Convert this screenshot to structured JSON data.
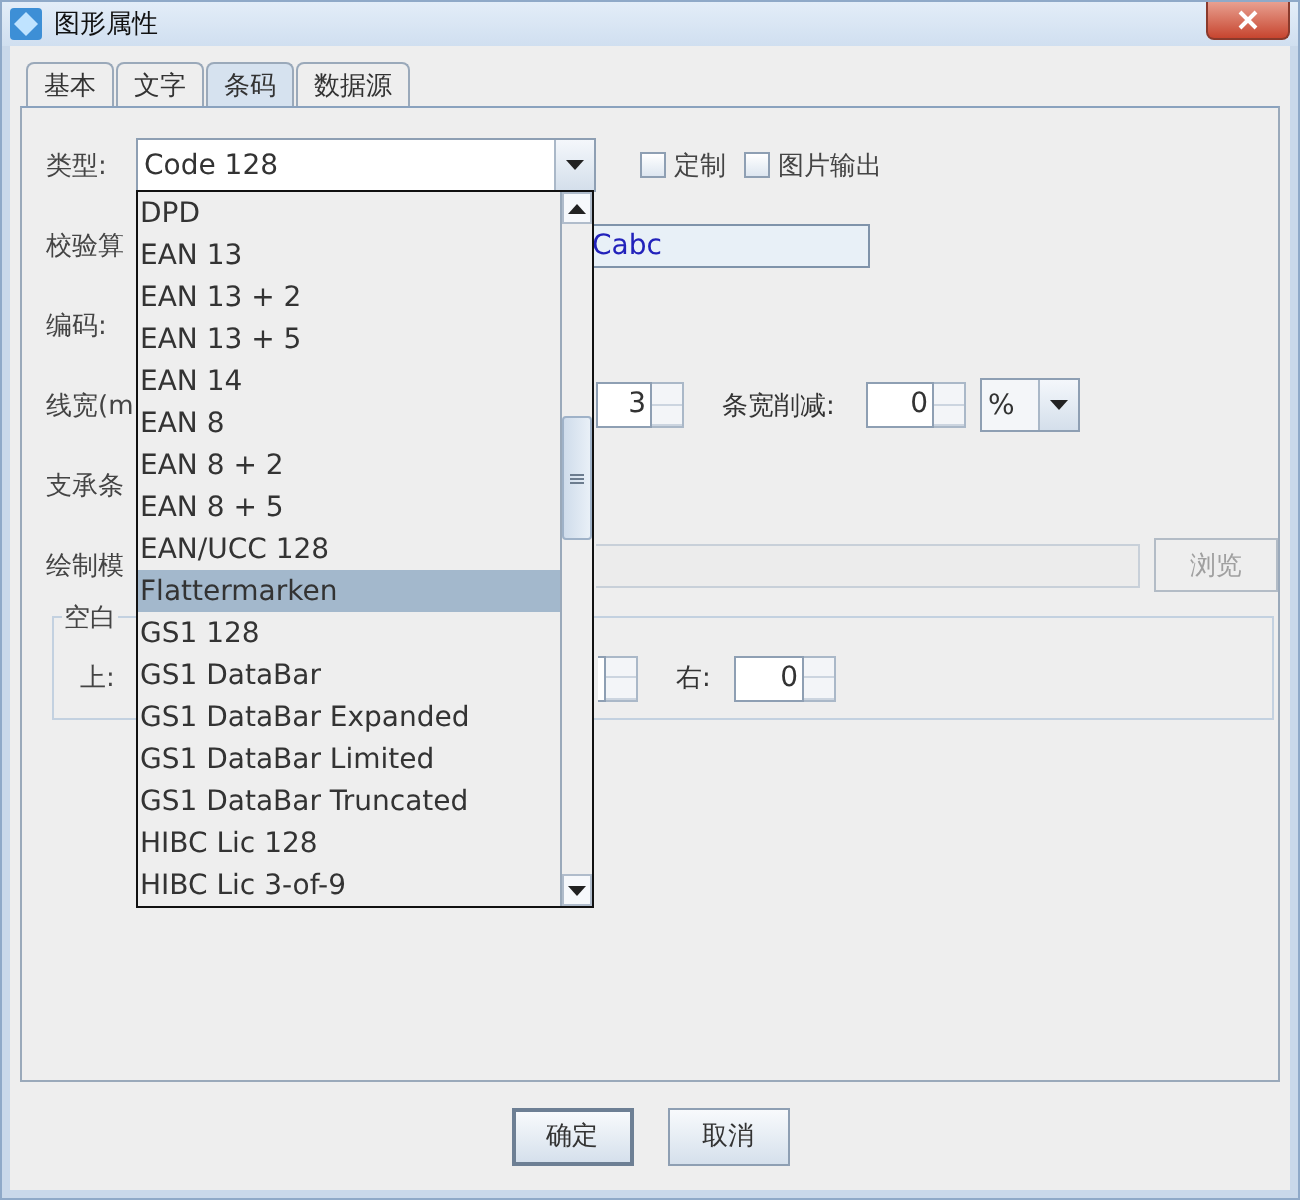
{
  "window": {
    "title": "图形属性"
  },
  "tabs": [
    {
      "label": "基本",
      "selected": false
    },
    {
      "label": "文字",
      "selected": false
    },
    {
      "label": "条码",
      "selected": true
    },
    {
      "label": "数据源",
      "selected": false
    }
  ],
  "barcode_type": {
    "label": "类型:",
    "value": "Code 128",
    "options": [
      {
        "label": "DPD",
        "selected": false
      },
      {
        "label": "EAN 13",
        "selected": false
      },
      {
        "label": "EAN 13 + 2",
        "selected": false
      },
      {
        "label": "EAN 13 + 5",
        "selected": false
      },
      {
        "label": "EAN 14",
        "selected": false
      },
      {
        "label": "EAN 8",
        "selected": false
      },
      {
        "label": "EAN 8 + 2",
        "selected": false
      },
      {
        "label": "EAN 8 + 5",
        "selected": false
      },
      {
        "label": "EAN/UCC 128",
        "selected": false
      },
      {
        "label": "Flattermarken",
        "selected": true
      },
      {
        "label": "GS1 128",
        "selected": false
      },
      {
        "label": "GS1 DataBar",
        "selected": false
      },
      {
        "label": "GS1 DataBar Expanded",
        "selected": false
      },
      {
        "label": "GS1 DataBar Limited",
        "selected": false
      },
      {
        "label": "GS1 DataBar Truncated",
        "selected": false
      },
      {
        "label": "HIBC Lic 128",
        "selected": false
      },
      {
        "label": "HIBC Lic 3-of-9",
        "selected": false
      }
    ]
  },
  "checkboxes": [
    {
      "label": "定制",
      "checked": false
    },
    {
      "label": "图片输出",
      "checked": false
    }
  ],
  "check_algorithm": {
    "label": "校验算",
    "value": "Cabc"
  },
  "encoding": {
    "label": "编码:"
  },
  "line_width": {
    "label": "线宽(m",
    "value": "3",
    "reduction_label": "条宽削减:",
    "reduction_value": "0",
    "unit": "%"
  },
  "support_bar": {
    "label": "支承条"
  },
  "draw_mode": {
    "label": "绘制模",
    "disabled": true,
    "browse_button": {
      "label": "浏览",
      "disabled": true
    }
  },
  "quiet_zone": {
    "title": "空白",
    "top_label": "上:",
    "right_label": "右:",
    "right_value": "0"
  },
  "buttons": [
    {
      "label": "确定",
      "default": true
    },
    {
      "label": "取消",
      "default": false
    }
  ]
}
